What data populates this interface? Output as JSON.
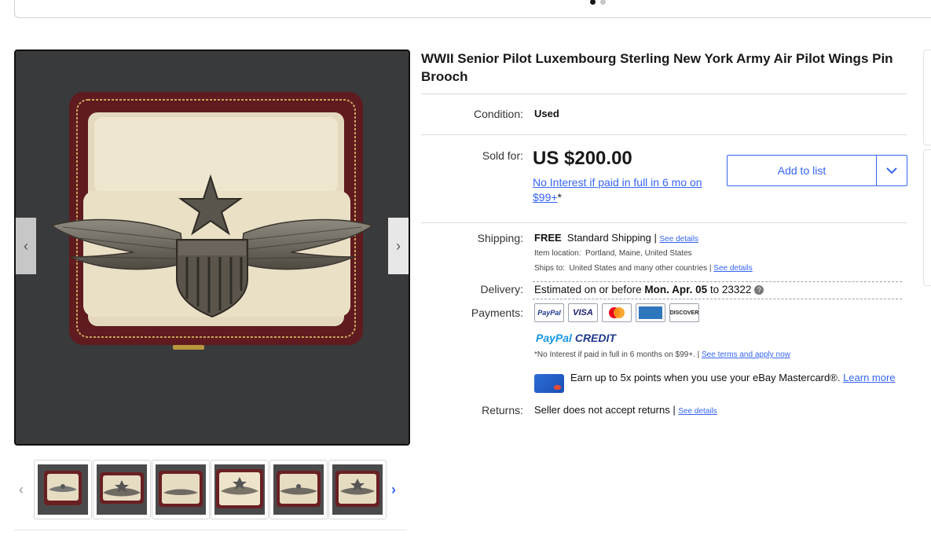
{
  "carousel": {
    "dots": 2,
    "active": 0
  },
  "listing": {
    "title": "WWII Senior Pilot Luxembourg Sterling New York Army Air Pilot Wings Pin Brooch",
    "condition_label": "Condition:",
    "condition_value": "Used",
    "sold_label": "Sold for:",
    "price": "US $200.00",
    "interest_link": "No Interest if paid in full in 6 mo on $99+",
    "interest_star": "*",
    "add_to_list": "Add to list",
    "shipping_label": "Shipping:",
    "shipping_free": "FREE",
    "shipping_method": "Standard Shipping |",
    "see_details": "See details",
    "item_location_label": "Item location:",
    "item_location": "Portland, Maine, United States",
    "ships_to_label": "Ships to:",
    "ships_to": "United States and many other countries |",
    "delivery_label": "Delivery:",
    "delivery_prefix": "Estimated on or before",
    "delivery_date": "Mon. Apr. 05",
    "delivery_suffix": "to 23322",
    "payments_label": "Payments:",
    "pay_methods": [
      "PayPal",
      "VISA",
      "Mastercard",
      "AmEx",
      "DISCOVER"
    ],
    "paypal_credit_pay": "PayPal",
    "paypal_credit_word": "CREDIT",
    "ppc_note": "*No Interest if paid in full in 6 months on $99+.  |",
    "ppc_terms": "See terms and apply now",
    "mastercard_promo": "Earn up to 5x points when you use your eBay Mastercard®.",
    "mastercard_learn": "Learn more",
    "returns_label": "Returns:",
    "returns_value": "Seller does not accept returns |"
  },
  "gallery": {
    "thumb_count": 6
  },
  "colors": {
    "link": "#3665f3",
    "box": "#6b1f22",
    "gold": "#c9a45c",
    "cream": "#efe6cf",
    "slate": "#3e3f41"
  }
}
